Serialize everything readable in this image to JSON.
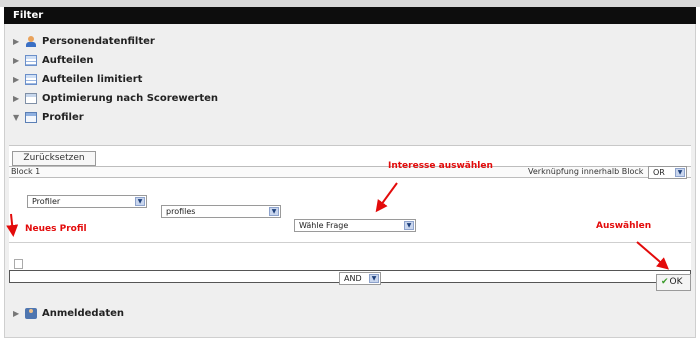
{
  "window": {
    "title": "Filter"
  },
  "tree": {
    "items": [
      {
        "label": "Personendatenfilter",
        "icon": "person-filter-icon",
        "expanded": false
      },
      {
        "label": "Aufteilen",
        "icon": "list-icon",
        "expanded": false
      },
      {
        "label": "Aufteilen limitiert",
        "icon": "list-icon",
        "expanded": false
      },
      {
        "label": "Optimierung nach Scorewerten",
        "icon": "grid-icon",
        "expanded": false
      },
      {
        "label": "Profiler",
        "icon": "form-icon",
        "expanded": true
      }
    ],
    "bottom_item": {
      "label": "Anmeldedaten",
      "icon": "user-data-icon",
      "expanded": false
    }
  },
  "profiler": {
    "reset_label": "Zurücksetzen",
    "block_label": "Block 1",
    "link_label": "Verknüpfung innerhalb Block",
    "link_value": "OR",
    "type_value": "Profiler",
    "source_value": "profiles",
    "question_value": "Wähle Frage",
    "connector_value": "AND",
    "ok_label": "OK"
  },
  "annotations": {
    "interest": "Interesse auswählen",
    "new_profile": "Neues Profil",
    "select": "Auswählen"
  },
  "colors": {
    "header_bg": "#0d0d0d",
    "annotation": "#e30b0b",
    "ok_check": "#3a9a2a"
  }
}
